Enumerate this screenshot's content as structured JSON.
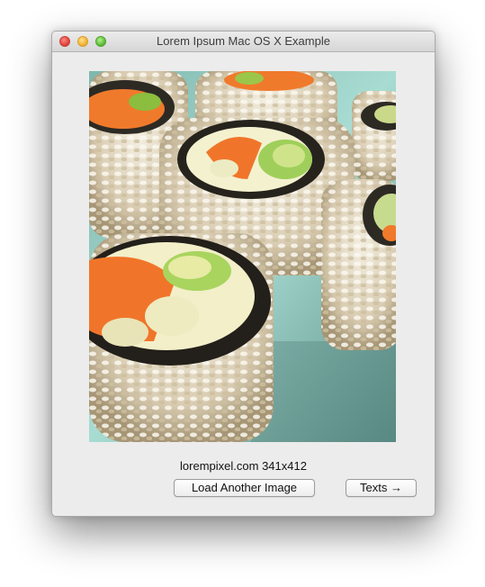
{
  "window": {
    "title": "Lorem Ipsum Mac OS X Example"
  },
  "image": {
    "caption": "lorempixel.com 341x412"
  },
  "buttons": {
    "load_label": "Load Another Image",
    "texts_label": "Texts →"
  },
  "colors": {
    "close": "#e0443e",
    "minimize": "#f2b53a",
    "maximize": "#5fbf3c",
    "window_bg": "#ececec"
  }
}
